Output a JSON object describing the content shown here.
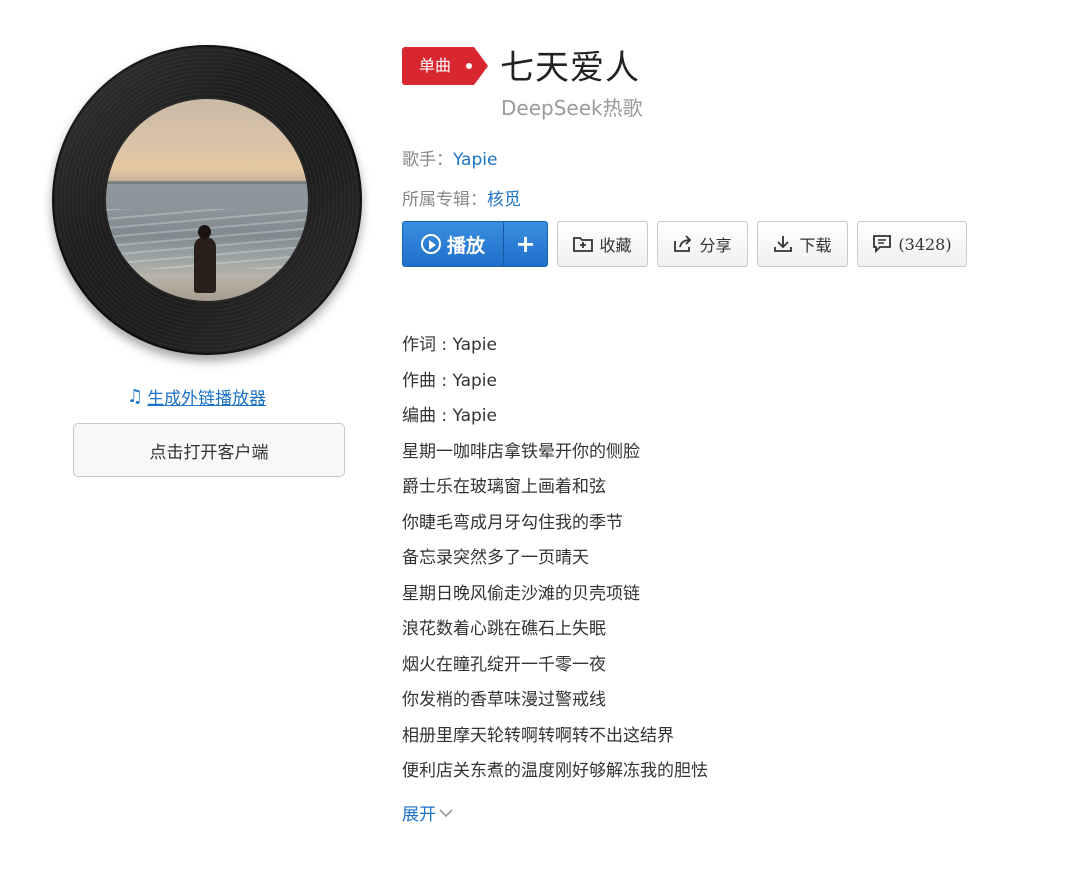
{
  "cover": {
    "alt": "album cover vinyl"
  },
  "embed_player": {
    "label": "生成外链播放器",
    "icon": "music-note-icon"
  },
  "open_client": {
    "label": "点击打开客户端"
  },
  "song": {
    "tag": "单曲",
    "title": "七天爱人",
    "subtitle": "DeepSeek热歌",
    "artist_label": "歌手：",
    "artist": "Yapie",
    "album_label": "所属专辑：",
    "album": "核觅"
  },
  "actions": {
    "play": "播放",
    "add": "+",
    "collect": "收藏",
    "share": "分享",
    "download": "下载",
    "comments": "(3428)"
  },
  "lyrics": [
    "作词 : Yapie",
    "作曲 : Yapie",
    "编曲 : Yapie",
    "星期一咖啡店拿铁晕开你的侧脸",
    "爵士乐在玻璃窗上画着和弦",
    "你睫毛弯成月牙勾住我的季节",
    "备忘录突然多了一页晴天",
    "星期日晚风偷走沙滩的贝壳项链",
    "浪花数着心跳在礁石上失眠",
    "烟火在瞳孔绽开一千零一夜",
    "你发梢的香草味漫过警戒线",
    "相册里摩天轮转啊转啊转不出这结界",
    "便利店关东煮的温度刚好够解冻我的胆怯"
  ],
  "expand": {
    "label": "展开"
  },
  "colors": {
    "link": "#1a73c7",
    "tag": "#d8272f",
    "play": "#1f6fc8"
  }
}
